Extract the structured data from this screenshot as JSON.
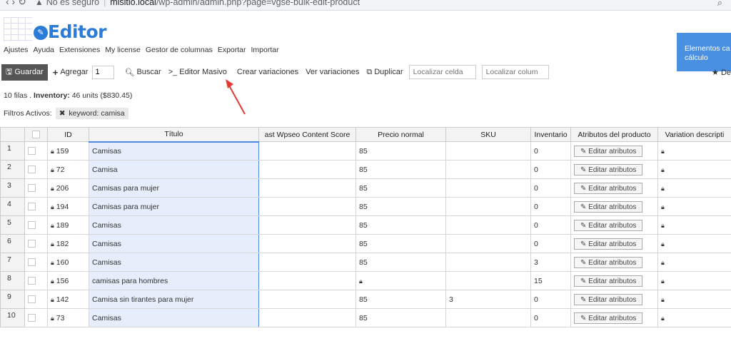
{
  "browser": {
    "security_label": "No es seguro",
    "url_host": "misitio.local",
    "url_path": "/wp-admin/admin.php?page=vgse-bulk-edit-product"
  },
  "logo": {
    "text": "Editor"
  },
  "menu": [
    "Ajustes",
    "Ayuda",
    "Extensiones",
    "My license",
    "Gestor de columnas",
    "Exportar",
    "Importar"
  ],
  "notice": {
    "text": "Elementos ca cálculo"
  },
  "toolbar": {
    "save_label": "Guardar",
    "add_label": "Agregar",
    "add_qty": "1",
    "search_label": "Buscar",
    "bulk_edit_label": ">_ Editor Masivo",
    "create_variations_label": "Crear variaciones",
    "view_variations_label": "Ver variaciones",
    "duplicate_label": "Duplicar",
    "locate_cell_placeholder": "Localizar celda",
    "locate_column_placeholder": "Localizar colum",
    "right_cut_label": "De"
  },
  "info": {
    "rows": "10 filas .",
    "inventory_label": "Inventory:",
    "inventory_value": "46 units ($830.45)"
  },
  "filters": {
    "label": "Filtros Activos:",
    "chip": "keyword: camisa"
  },
  "table": {
    "headers": [
      "",
      "ID",
      "Título",
      "ast Wpseo Content Score",
      "Precio normal",
      "SKU",
      "Inventario",
      "Atributos del producto",
      "Variation descripti"
    ],
    "attr_button_label": "Editar atributos",
    "rows": [
      {
        "n": "1",
        "id": "159",
        "title": "Camisas",
        "score": "",
        "price": "85",
        "sku": "",
        "inv": "0"
      },
      {
        "n": "2",
        "id": "72",
        "title": "Camisa",
        "score": "",
        "price": "85",
        "sku": "",
        "inv": "0"
      },
      {
        "n": "3",
        "id": "206",
        "title": "Camisas para mujer",
        "score": "",
        "price": "85",
        "sku": "",
        "inv": "0"
      },
      {
        "n": "4",
        "id": "194",
        "title": "Camisas para mujer",
        "score": "",
        "price": "85",
        "sku": "",
        "inv": "0"
      },
      {
        "n": "5",
        "id": "189",
        "title": "Camisas",
        "score": "",
        "price": "85",
        "sku": "",
        "inv": "0"
      },
      {
        "n": "6",
        "id": "182",
        "title": "Camisas",
        "score": "",
        "price": "85",
        "sku": "",
        "inv": "0"
      },
      {
        "n": "7",
        "id": "160",
        "title": "Camisas",
        "score": "",
        "price": "85",
        "sku": "",
        "inv": "3"
      },
      {
        "n": "8",
        "id": "156",
        "title": "camisas para hombres",
        "score": "",
        "price": "",
        "sku": "",
        "inv": "15"
      },
      {
        "n": "9",
        "id": "142",
        "title": "Camisa sin tirantes para mujer",
        "score": "",
        "price": "85",
        "sku": "3",
        "inv": "0"
      },
      {
        "n": "10",
        "id": "73",
        "title": "Camisas",
        "score": "",
        "price": "85",
        "sku": "",
        "inv": "0"
      }
    ]
  }
}
